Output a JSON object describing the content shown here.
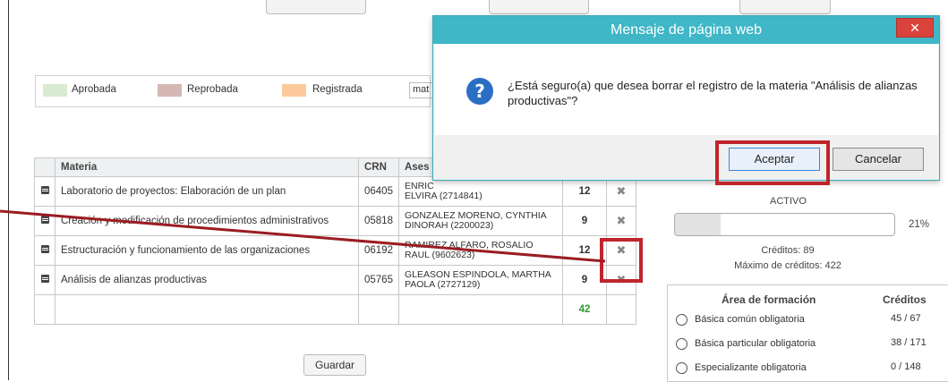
{
  "legend": [
    {
      "label": "Aprobada",
      "color": "#d9ead3"
    },
    {
      "label": "Reprobada",
      "color": "#d5b8b5"
    },
    {
      "label": "Registrada",
      "color": "#fcc99a"
    }
  ],
  "search": {
    "value": "mat"
  },
  "table": {
    "headers": {
      "materia": "Materia",
      "crn": "CRN",
      "asesor": "Ases"
    },
    "rows": [
      {
        "materia": "Laboratorio de proyectos: Elaboración de un plan",
        "crn": "06405",
        "asesor": "ENRIC\nELVIRA (2714841)",
        "creditos": "12"
      },
      {
        "materia": "Creación y modificación de procedimientos administrativos",
        "crn": "05818",
        "asesor": "GONZALEZ MORENO, CYNTHIA DINORAH (2200023)",
        "creditos": "9"
      },
      {
        "materia": "Estructuración y funcionamiento de las organizaciones",
        "crn": "06192",
        "asesor": "RAMIREZ ALFARO, ROSALIO RAUL (9602623)",
        "creditos": "12"
      },
      {
        "materia": "Análisis de alianzas productivas",
        "crn": "05765",
        "asesor": "GLEASON ESPINDOLA, MARTHA PAOLA (2727129)",
        "creditos": "9"
      }
    ],
    "total": "42"
  },
  "guardar_label": "Guardar",
  "status": {
    "estado": "ACTIVO",
    "progress_percent": 21,
    "progress_label": "21%",
    "creditos": "Créditos: 89",
    "maximo": "Máximo de créditos: 422"
  },
  "area": {
    "header_area": "Área de formación",
    "header_creditos": "Créditos",
    "rows": [
      {
        "label": "Básica común obligatoria",
        "value": "45 / 67"
      },
      {
        "label": "Básica particular obligatoria",
        "value": "38 / 171"
      },
      {
        "label": "Especializante obligatoria",
        "value": "0 / 148"
      }
    ]
  },
  "modal": {
    "title": "Mensaje de página web",
    "close": "✕",
    "message": "¿Está seguro(a) que desea borrar el registro de la materia \"Análisis de alianzas productivas\"?",
    "accept": "Aceptar",
    "cancel": "Cancelar"
  },
  "colors": {
    "titlebar": "#3fb7c6",
    "close": "#d9433b",
    "annotation": "#c0242c",
    "total": "#2e9b2e"
  }
}
